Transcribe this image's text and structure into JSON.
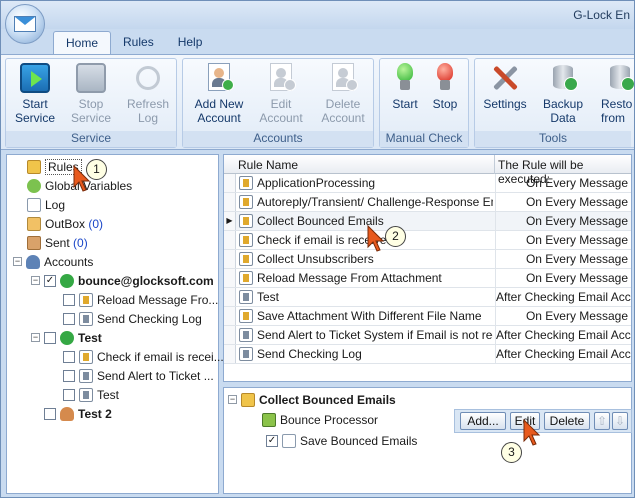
{
  "window": {
    "title": "G-Lock En"
  },
  "tabs": [
    "Home",
    "Rules",
    "Help"
  ],
  "ribbon": {
    "groups": [
      {
        "label": "Service",
        "buttons": [
          {
            "line1": "Start",
            "line2": "Service",
            "enabled": true,
            "icon": "play-icon"
          },
          {
            "line1": "Stop",
            "line2": "Service",
            "enabled": false,
            "icon": "stop-icon"
          },
          {
            "line1": "Refresh",
            "line2": "Log",
            "enabled": false,
            "icon": "refresh-icon"
          }
        ]
      },
      {
        "label": "Accounts",
        "buttons": [
          {
            "line1": "Add New",
            "line2": "Account",
            "enabled": true,
            "icon": "add-account-icon"
          },
          {
            "line1": "Edit",
            "line2": "Account",
            "enabled": false,
            "icon": "edit-account-icon"
          },
          {
            "line1": "Delete",
            "line2": "Account",
            "enabled": false,
            "icon": "delete-account-icon"
          }
        ]
      },
      {
        "label": "Manual Check",
        "buttons": [
          {
            "line1": "Start",
            "line2": "",
            "enabled": true,
            "icon": "green-light-icon"
          },
          {
            "line1": "Stop",
            "line2": "",
            "enabled": true,
            "icon": "red-light-icon"
          }
        ]
      },
      {
        "label": "Tools",
        "buttons": [
          {
            "line1": "Settings",
            "line2": "",
            "enabled": true,
            "icon": "settings-tools-icon"
          },
          {
            "line1": "Backup",
            "line2": "Data",
            "enabled": true,
            "icon": "backup-db-icon"
          },
          {
            "line1": "Resto",
            "line2": "from",
            "enabled": true,
            "icon": "restore-db-icon"
          }
        ]
      }
    ]
  },
  "tree": {
    "rules": "Rules",
    "global_variables": "Global Variables",
    "log": "Log",
    "outbox": {
      "label": "OutBox",
      "count": "(0)"
    },
    "sent": {
      "label": "Sent",
      "count": "(0)"
    },
    "accounts": "Accounts",
    "account1": {
      "name": "bounce@glocksoft.com",
      "checked": true,
      "rules": [
        "Reload Message Fro...",
        "Send Checking Log"
      ]
    },
    "account2": {
      "name": "Test",
      "checked": false,
      "rules": [
        "Check if email is recei...",
        "Send Alert to Ticket ...",
        "Test"
      ]
    },
    "account3": {
      "name": "Test 2",
      "checked": false
    }
  },
  "rules_grid": {
    "col_name": "Rule Name",
    "col_exec": "The Rule will be executed:",
    "rows": [
      {
        "name": "ApplicationProcessing",
        "exec": "On Every Message",
        "type": "yellow"
      },
      {
        "name": "Autoreply/Transient/ Challenge-Response Emails",
        "exec": "On Every Message",
        "type": "yellow"
      },
      {
        "name": "Collect Bounced Emails",
        "exec": "On Every Message",
        "type": "yellow",
        "selected": true
      },
      {
        "name": "Check if email is received",
        "exec": "On Every Message",
        "type": "yellow"
      },
      {
        "name": "Collect Unsubscribers",
        "exec": "On Every Message",
        "type": "yellow"
      },
      {
        "name": "Reload Message From Attachment",
        "exec": "On Every Message",
        "type": "yellow"
      },
      {
        "name": "Test",
        "exec": "After Checking Email Acc...",
        "type": "grey"
      },
      {
        "name": "Save Attachment With Different File Name",
        "exec": "On Every Message",
        "type": "yellow"
      },
      {
        "name": "Send Alert to Ticket System if Email is not recei...",
        "exec": "After Checking Email Acc...",
        "type": "grey"
      },
      {
        "name": "Send Checking Log",
        "exec": "After Checking Email Acc...",
        "type": "grey"
      }
    ]
  },
  "detail": {
    "title": "Collect Bounced Emails",
    "processor": "Bounce Processor",
    "action": "Save Bounced Emails",
    "action_checked": true,
    "buttons": {
      "add": "Add...",
      "edit": "Edit",
      "delete": "Delete"
    }
  },
  "callouts": [
    "1",
    "2",
    "3"
  ]
}
